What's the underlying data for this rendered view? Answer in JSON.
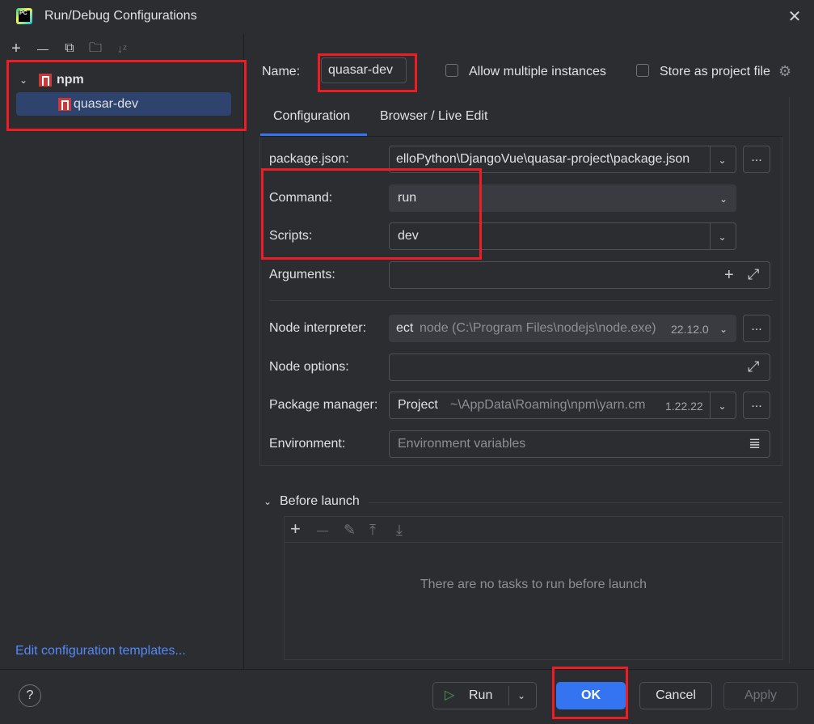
{
  "window": {
    "title": "Run/Debug Configurations",
    "close_glyph": "✕",
    "app_icon_text": "PC"
  },
  "toolbar": {
    "add": "+",
    "remove": "—",
    "copy": "⧉",
    "folder": "🗀",
    "sort": "↓ᶻ"
  },
  "tree": {
    "group_expander": "⌄",
    "group_label": "npm",
    "items": [
      {
        "label": "quasar-dev",
        "selected": true
      }
    ]
  },
  "edit_templates_link": "Edit configuration templates...",
  "form": {
    "name_label": "Name:",
    "name_value": "quasar-dev",
    "allow_multiple_label": "Allow multiple instances",
    "store_as_project_label": "Store as project file",
    "tabs": [
      {
        "label": "Configuration",
        "active": true
      },
      {
        "label": "Browser / Live Edit",
        "active": false
      }
    ],
    "package_json": {
      "label": "package.json:",
      "value": "elloPython\\DjangoVue\\quasar-project\\package.json"
    },
    "command": {
      "label": "Command:",
      "value": "run"
    },
    "scripts": {
      "label": "Scripts:",
      "value": "dev"
    },
    "arguments": {
      "label": "Arguments:",
      "value": ""
    },
    "node_interpreter": {
      "label": "Node interpreter:",
      "prefix": "ect",
      "path": "node (C:\\Program Files\\nodejs\\node.exe)",
      "version": "22.12.0"
    },
    "node_options": {
      "label": "Node options:",
      "value": ""
    },
    "package_manager": {
      "label": "Package manager:",
      "prefix": "Project",
      "path": "~\\AppData\\Roaming\\npm\\yarn.cm",
      "version": "1.22.22"
    },
    "environment": {
      "label": "Environment:",
      "placeholder": "Environment variables"
    },
    "dots": "...",
    "dropdown_glyph": "⌄",
    "plus_glyph": "+",
    "expand_glyph": "⤢",
    "env_glyph": "≣"
  },
  "before_launch": {
    "chevron": "⌄",
    "label": "Before launch",
    "empty_text": "There are no tasks to run before launch",
    "tools": {
      "add": "+",
      "remove": "—",
      "edit": "✎",
      "up": "⤒",
      "down": "⤓"
    }
  },
  "buttons": {
    "help": "?",
    "run": "Run",
    "run_glyph": "▷",
    "run_dropdown": "⌄",
    "ok": "OK",
    "cancel": "Cancel",
    "apply": "Apply"
  },
  "colors": {
    "accent": "#3574f0",
    "annotation_red": "#ee1c25",
    "npm_red": "#cb3837",
    "link": "#548af7",
    "run_green": "#57965c"
  }
}
